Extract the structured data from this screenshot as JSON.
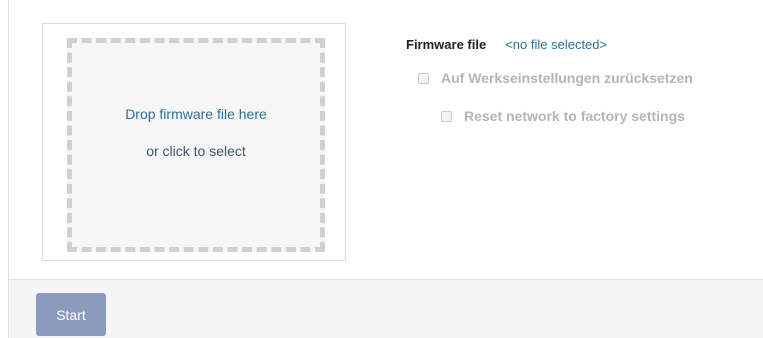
{
  "dropzone": {
    "line1": "Drop firmware file here",
    "line2": "or click to select"
  },
  "firmware": {
    "label": "Firmware file",
    "value": "<no file selected>"
  },
  "options": [
    {
      "label": "Auf Werkseinstellungen zurücksetzen",
      "checked": false,
      "disabled": true
    },
    {
      "label": "Reset network to factory settings",
      "checked": false,
      "disabled": true
    }
  ],
  "footer": {
    "start_label": "Start"
  },
  "colors": {
    "link": "#2e6f99",
    "disabled_text": "#b5b5b5",
    "button_bg": "#8c9bbd"
  }
}
